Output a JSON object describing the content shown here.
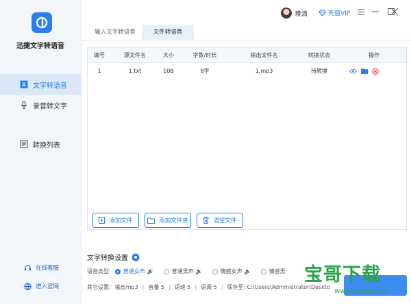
{
  "app": {
    "name": "迅捷文字转语音"
  },
  "sidebar": {
    "items": [
      {
        "label": "文字转语音",
        "icon": "text-to-speech-icon",
        "active": true
      },
      {
        "label": "录音转文字",
        "icon": "microphone-icon",
        "active": false
      },
      {
        "label": "转换列表",
        "icon": "list-icon",
        "active": false
      }
    ],
    "footer": [
      {
        "label": "在线客服",
        "icon": "headset-icon"
      },
      {
        "label": "进入官网",
        "icon": "globe-icon"
      }
    ]
  },
  "header": {
    "user_name": "晚清",
    "vip_label": "充值VIP",
    "window_controls": [
      "menu-icon",
      "minimize-icon",
      "maximize-icon",
      "close-icon"
    ]
  },
  "tabs": [
    {
      "label": "输入文字转语音",
      "active": false
    },
    {
      "label": "文件转语音",
      "active": true
    }
  ],
  "table": {
    "headers": [
      "编号",
      "源文件名",
      "大小",
      "字数/时长",
      "输出文件名",
      "转换状态",
      "操作"
    ],
    "rows": [
      {
        "index": "1",
        "source": "1.txt",
        "size": "10B",
        "length": "8字",
        "output": "1.mp3",
        "status": "待转换"
      }
    ]
  },
  "buttons": {
    "add_file": "添加文件",
    "add_folder": "添加文件夹",
    "clear_files": "清空文件"
  },
  "settings": {
    "title": "文字转换设置",
    "voice_type_label": "语音类型:",
    "voices": [
      {
        "label": "普通女声",
        "selected": true
      },
      {
        "label": "普通男声",
        "selected": false
      },
      {
        "label": "情感女声",
        "selected": false
      },
      {
        "label": "情感男",
        "selected": false
      }
    ],
    "other_label": "其它设置:",
    "output_format": "输出mp3",
    "volume": "音量 5",
    "speed": "语速 5",
    "pitch": "语调 5",
    "save_to": "保存至: C:\\Users\\Administrator\\Deskto"
  },
  "watermark": {
    "text": "宝哥下载",
    "url": "www.baoge.net"
  },
  "colors": {
    "accent": "#2a7ff0",
    "sidebar_bg": "#f2f6fb",
    "watermark": "#2aa34a",
    "danger": "#e0443e"
  }
}
